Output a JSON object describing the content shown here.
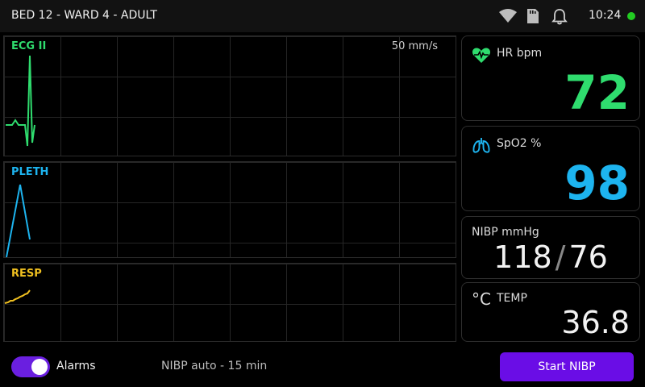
{
  "header": {
    "title": "BED 12 - WARD 4 - ADULT",
    "time": "10:24",
    "status_color": "#22cc22",
    "icons": [
      "wifi-icon",
      "sd-card-icon",
      "bell-icon"
    ]
  },
  "waveforms": {
    "ecg": {
      "label": "ECG II",
      "speed": "50 mm/s",
      "color": "#2fdc6e"
    },
    "pleth": {
      "label": "PLETH",
      "color": "#1db4ef"
    },
    "resp": {
      "label": "RESP",
      "color": "#f0c020"
    }
  },
  "vitals": {
    "hr": {
      "label": "HR bpm",
      "value": "72",
      "color": "#2fdc6e",
      "icon": "heart-pulse-icon"
    },
    "spo2": {
      "label": "SpO2 %",
      "value": "98",
      "color": "#1db4ef",
      "icon": "lungs-icon"
    },
    "nibp": {
      "label": "NIBP mmHg",
      "systolic": "118",
      "separator": "/",
      "diastolic": "76"
    },
    "temp": {
      "label": "TEMP",
      "unit_symbol": "°C",
      "value": "36.8"
    }
  },
  "footer": {
    "alarms_label": "Alarms",
    "alarms_on": true,
    "toggle_color": "#6a1fe0",
    "nibp_auto": "NIBP auto - 15 min",
    "start_button": "Start NIBP",
    "button_color": "#6a0de6"
  }
}
